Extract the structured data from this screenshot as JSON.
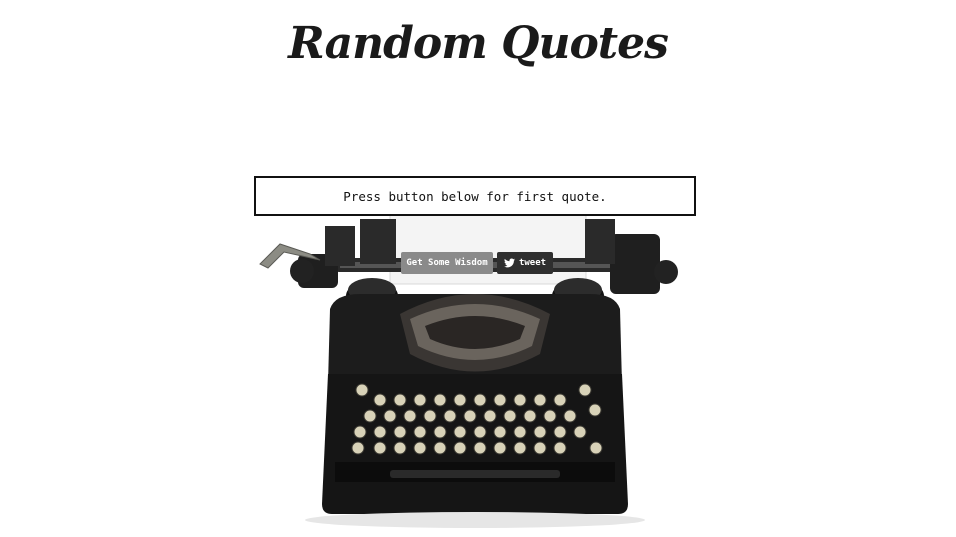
{
  "header": {
    "title": "Random Quotes"
  },
  "quote": {
    "text": "Press button below for first quote."
  },
  "actions": {
    "wisdom_label": "Get Some Wisdom",
    "tweet_label": "tweet",
    "tweet_icon": "twitter-bird-icon"
  },
  "colors": {
    "background": "#ffffff",
    "text": "#111111",
    "wisdom_button": "#8a8a8a",
    "tweet_button": "#2f2f2f"
  },
  "background_image": "typewriter-illustration"
}
